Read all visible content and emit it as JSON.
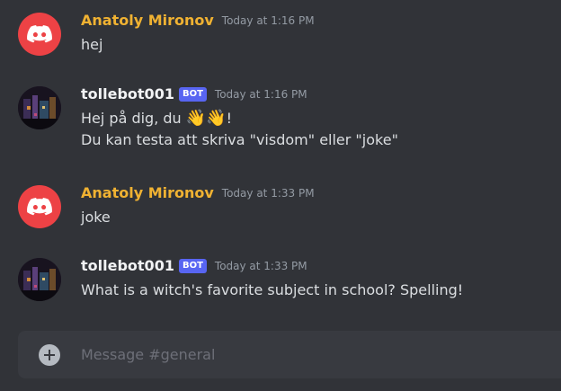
{
  "messages": [
    {
      "author": "Anatoly Mironov",
      "avatar_icon": "discord-logo-icon",
      "is_bot": false,
      "timestamp": "Today at 1:16 PM",
      "lines": [
        "hej"
      ]
    },
    {
      "author": "tollebot001",
      "avatar_icon": "photo-avatar",
      "is_bot": true,
      "bot_tag": "BOT",
      "timestamp": "Today at 1:16 PM",
      "line1_prefix": "Hej på dig, du ",
      "line1_emoji": "👋👋",
      "line1_suffix": "!",
      "line2": "Du kan testa att skriva \"visdom\" eller \"joke\""
    },
    {
      "author": "Anatoly Mironov",
      "avatar_icon": "discord-logo-icon",
      "is_bot": false,
      "timestamp": "Today at 1:33 PM",
      "lines": [
        "joke"
      ]
    },
    {
      "author": "tollebot001",
      "avatar_icon": "photo-avatar",
      "is_bot": true,
      "bot_tag": "BOT",
      "timestamp": "Today at 1:33 PM",
      "lines": [
        "What is a witch's favorite subject in school? Spelling!"
      ]
    }
  ],
  "composer": {
    "placeholder": "Message #general",
    "add_icon": "plus-circle-icon"
  },
  "colors": {
    "background": "#313338",
    "composer_bg": "#383a40",
    "user_name": "#f0b232",
    "bot_tag": "#5865f2",
    "discord_red": "#ed4245"
  }
}
